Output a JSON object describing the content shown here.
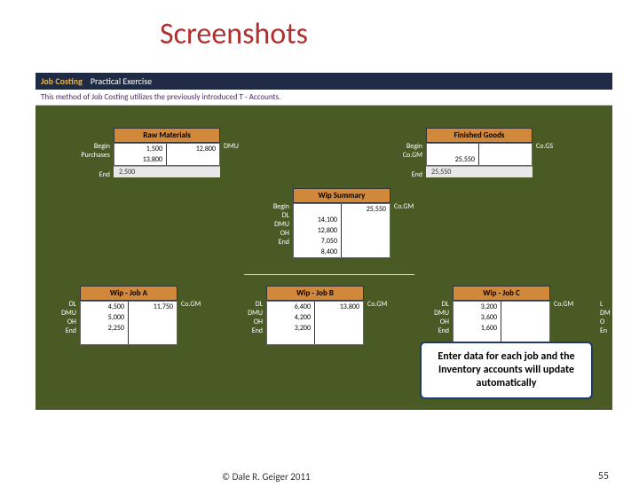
{
  "title": "Screenshots",
  "header": {
    "main": "Job Costing",
    "sub": "Practical Exercise"
  },
  "note": "This method of Job Costing utilizes the previously introduced T - Accounts.",
  "accounts": {
    "raw": {
      "title": "Raw Materials",
      "labels": {
        "begin": "Begin",
        "purchases": "Purchases",
        "end": "End",
        "out": "DMU"
      },
      "leftVals": [
        "1,500",
        "13,800"
      ],
      "rightVals": [
        "12,800"
      ],
      "end": "2,500"
    },
    "fg": {
      "title": "Finished Goods",
      "labels": {
        "begin": "Begin",
        "cogm": "Co.GM",
        "end": "End",
        "out": "Co.GS"
      },
      "leftVals": [
        "",
        "25,550"
      ],
      "rightVals": [
        ""
      ],
      "end": "25,550"
    },
    "wipSummary": {
      "title": "Wip Summary",
      "rows": [
        {
          "lab": "Begin",
          "val": "",
          "out": "25,550",
          "outLab": "Co.GM"
        },
        {
          "lab": "DL",
          "val": "14,100"
        },
        {
          "lab": "DMU",
          "val": "12,800"
        },
        {
          "lab": "OH",
          "val": "7,050"
        },
        {
          "lab": "End",
          "val": "8,400"
        }
      ]
    },
    "jobA": {
      "title": "Wip - Job A",
      "labs": [
        "DL",
        "DMU",
        "OH",
        "End"
      ],
      "left": [
        "4,500",
        "5,000",
        "2,250",
        ""
      ],
      "right": "11,750",
      "outLab": "Co.GM"
    },
    "jobB": {
      "title": "Wip - Job B",
      "labs": [
        "DL",
        "DMU",
        "OH",
        "End"
      ],
      "left": [
        "6,400",
        "4,200",
        "3,200",
        ""
      ],
      "right": "13,800",
      "outLab": "Co.GM"
    },
    "jobC": {
      "title": "Wip - Job C",
      "labs": [
        "DL",
        "DMU",
        "OH",
        "End"
      ],
      "left": [
        "3,200",
        "3,600",
        "1,600",
        ""
      ],
      "right": "",
      "outLab": "Co.GM",
      "extra": [
        "L",
        "DM",
        "O",
        "En"
      ]
    }
  },
  "callout": "Enter data for each job and the Inventory accounts will update automatically",
  "footer": {
    "copyright": "© Dale R. Geiger 2011",
    "page": "55"
  }
}
